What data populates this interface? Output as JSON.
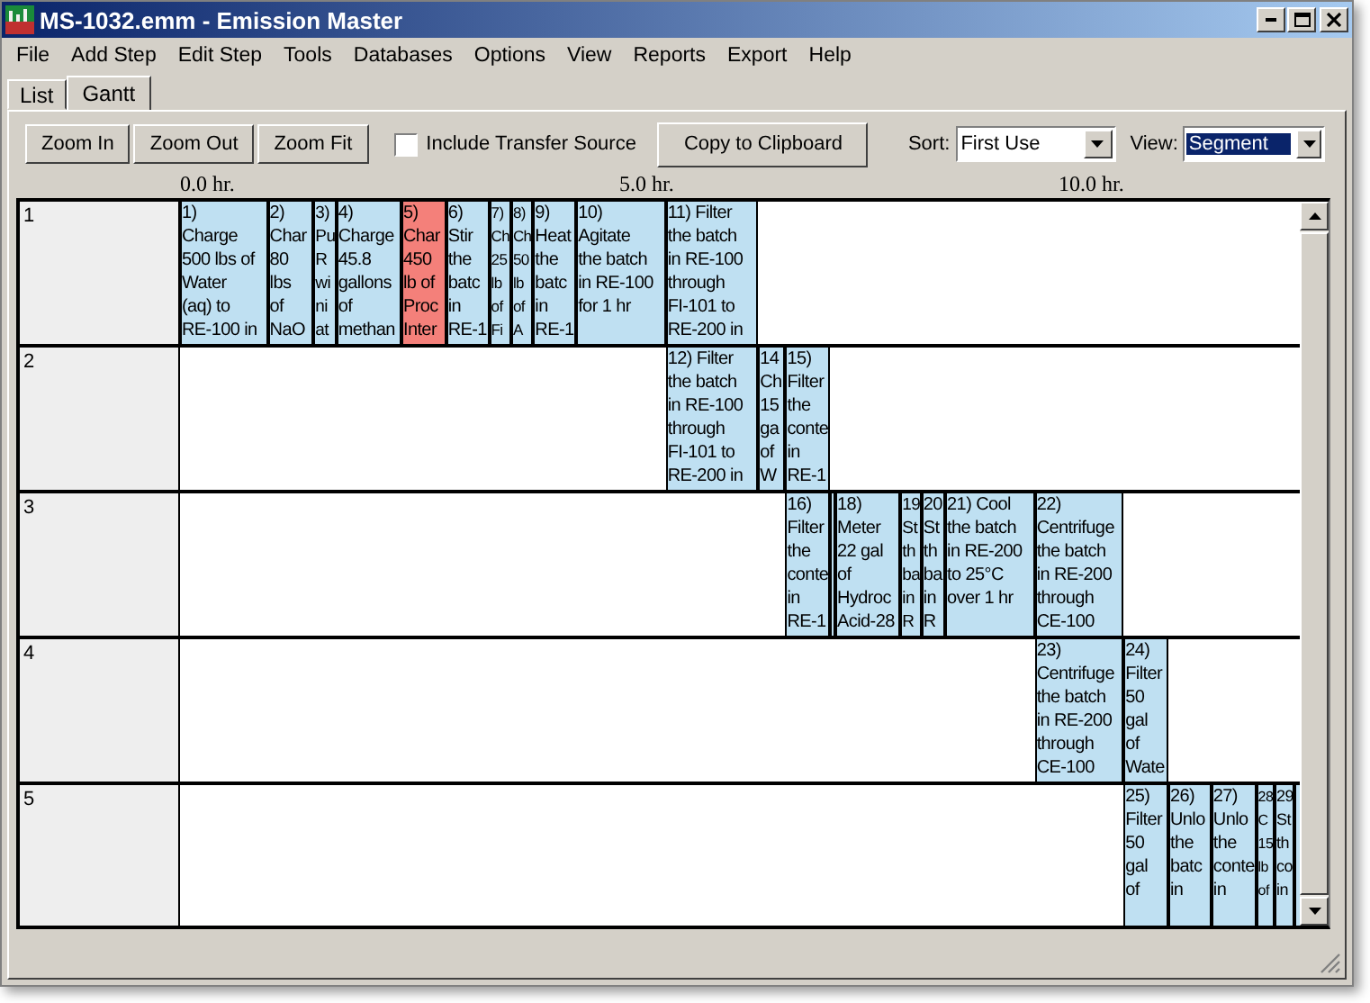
{
  "window": {
    "title": "MS-1032.emm - Emission Master"
  },
  "menu": [
    "File",
    "Add Step",
    "Edit Step",
    "Tools",
    "Databases",
    "Options",
    "View",
    "Reports",
    "Export",
    "Help"
  ],
  "tabs": [
    {
      "label": "List",
      "selected": false
    },
    {
      "label": "Gantt",
      "selected": true
    }
  ],
  "toolbar": {
    "buttons": [
      "Zoom In",
      "Zoom Out",
      "Zoom Fit"
    ],
    "checkbox": {
      "label": "Include Transfer Source",
      "checked": false
    },
    "copy_button": "Copy to Clipboard",
    "sort": {
      "label": "Sort:",
      "value": "First Use",
      "focused": false
    },
    "view": {
      "label": "View:",
      "value": "Segment",
      "focused": true
    }
  },
  "gantt": {
    "ticks": [
      {
        "label": "0.0 hr."
      },
      {
        "label": "5.0 hr."
      },
      {
        "label": "10.0 hr."
      }
    ],
    "rows": [
      {
        "label": "1",
        "bars": [
          {
            "color": "#bfe0f2",
            "lines": [
              "1)",
              "Charge",
              "500 lbs of",
              "Water",
              "(aq) to",
              "RE-100 in"
            ]
          },
          {
            "color": "#bfe0f2",
            "lines": [
              "2)",
              "Char",
              "80",
              "lbs",
              "of",
              "NaO"
            ]
          },
          {
            "color": "#bfe0f2",
            "lines": [
              "3)",
              "Pu",
              "R",
              "wi",
              "ni",
              "at"
            ]
          },
          {
            "color": "#bfe0f2",
            "lines": [
              "4)",
              "Charge",
              "45.8",
              "gallons",
              "of",
              "methan"
            ]
          },
          {
            "color": "#f4807a",
            "lines": [
              "5)",
              "Char",
              "450",
              "lb of",
              "Proc",
              "Inter"
            ]
          },
          {
            "color": "#bfe0f2",
            "lines": [
              "6)",
              "Stir",
              "the",
              "batc",
              "in",
              "RE-1"
            ]
          },
          {
            "color": "#bfe0f2",
            "lines": [
              "7)",
              "Ch",
              "25",
              "lb",
              "of",
              "Fi"
            ]
          },
          {
            "color": "#bfe0f2",
            "lines": [
              "8)",
              "Ch",
              "50",
              "lb",
              "of",
              "A"
            ]
          },
          {
            "color": "#bfe0f2",
            "lines": [
              "9)",
              "Heat",
              "the",
              "batc",
              "in",
              "RE-1"
            ]
          },
          {
            "color": "#bfe0f2",
            "lines": [
              "10)",
              "Agitate",
              "the batch",
              "in RE-100",
              "for 1 hr"
            ]
          },
          {
            "color": "#bfe0f2",
            "lines": [
              "11) Filter",
              "the batch",
              "in RE-100",
              "through",
              "FI-101 to",
              "RE-200 in"
            ]
          }
        ]
      },
      {
        "label": "2",
        "bars": [
          {
            "color": "#bfe0f2",
            "lines": [
              "12) Filter",
              "the batch",
              "in RE-100",
              "through",
              "FI-101 to",
              "RE-200 in"
            ]
          },
          {
            "color": "#bfe0f2",
            "lines": [
              "14",
              "Ch",
              "15",
              "ga",
              "of",
              "W"
            ]
          },
          {
            "color": "#bfe0f2",
            "lines": [
              "15)",
              "Filter",
              "the",
              "conte",
              "in",
              "RE-1"
            ]
          }
        ]
      },
      {
        "label": "3",
        "bars": [
          {
            "color": "#bfe0f2",
            "lines": [
              "16)",
              "Filter",
              "the",
              "conte",
              "in",
              "RE-1"
            ]
          },
          {
            "color": "#bfe0f2"
          },
          {
            "color": "#bfe0f2",
            "lines": [
              "18)",
              "Meter",
              "22 gal",
              "of",
              "Hydroc",
              "Acid-28"
            ]
          },
          {
            "color": "#bfe0f2",
            "lines": [
              "19",
              "St",
              "th",
              "ba",
              "in",
              "R"
            ]
          },
          {
            "color": "#bfe0f2",
            "lines": [
              "20",
              "St",
              "th",
              "ba",
              "in",
              "R"
            ]
          },
          {
            "color": "#bfe0f2",
            "lines": [
              "21) Cool",
              "the batch",
              "in RE-200",
              "to 25°C",
              "over 1 hr"
            ]
          },
          {
            "color": "#bfe0f2",
            "lines": [
              "22)",
              "Centrifuge",
              "the batch",
              "in RE-200",
              "through",
              "CE-100"
            ]
          }
        ]
      },
      {
        "label": "4",
        "bars": [
          {
            "color": "#bfe0f2",
            "lines": [
              "23)",
              "Centrifuge",
              "the batch",
              "in RE-200",
              "through",
              "CE-100"
            ]
          },
          {
            "color": "#bfe0f2",
            "lines": [
              "24)",
              "Filter",
              "50",
              "gal",
              "of",
              "Wate"
            ]
          }
        ]
      },
      {
        "label": "5",
        "bars": [
          {
            "color": "#bfe0f2",
            "lines": [
              "25)",
              "Filter",
              "50",
              "gal",
              "of"
            ]
          },
          {
            "color": "#bfe0f2",
            "lines": [
              "26)",
              "Unlo",
              "the",
              "batc",
              "in"
            ]
          },
          {
            "color": "#bfe0f2",
            "lines": [
              "27)",
              "Unlo",
              "the",
              "conte",
              "in"
            ]
          },
          {
            "color": "#bfe0f2",
            "lines": [
              "28",
              "C",
              "15",
              "lb",
              "of"
            ]
          },
          {
            "color": "#bfe0f2",
            "lines": [
              "29",
              "St",
              "th",
              "co",
              "in"
            ]
          },
          {
            "color": "#bfe0f2"
          }
        ]
      }
    ]
  }
}
